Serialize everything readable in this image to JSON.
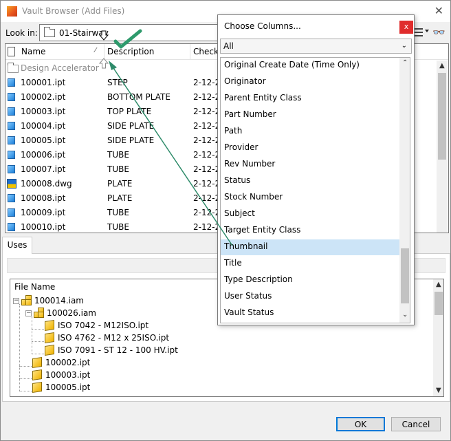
{
  "window": {
    "title": "Vault Browser (Add Files)",
    "close_glyph": "✕"
  },
  "lookin": {
    "label": "Look in:",
    "value": "01-Stairway"
  },
  "toolbar": {
    "view_icon": "details-view-icon",
    "find_icon": "binoculars-icon",
    "find_glyph": "👓"
  },
  "filelist": {
    "columns": [
      "Name",
      "Description",
      "Checke"
    ],
    "sort_glyph": "⁄",
    "group_label": "Design Accelerator",
    "rows": [
      {
        "name": "100001.ipt",
        "desc": "STEP",
        "date": "2-12-20",
        "type": "ipt"
      },
      {
        "name": "100002.ipt",
        "desc": "BOTTOM PLATE",
        "date": "2-12-20",
        "type": "ipt"
      },
      {
        "name": "100003.ipt",
        "desc": "TOP PLATE",
        "date": "2-12-20",
        "type": "ipt"
      },
      {
        "name": "100004.ipt",
        "desc": "SIDE PLATE",
        "date": "2-12-20",
        "type": "ipt"
      },
      {
        "name": "100005.ipt",
        "desc": "SIDE PLATE",
        "date": "2-12-20",
        "type": "ipt"
      },
      {
        "name": "100006.ipt",
        "desc": "TUBE",
        "date": "2-12-20",
        "type": "ipt"
      },
      {
        "name": "100007.ipt",
        "desc": "TUBE",
        "date": "2-12-20",
        "type": "ipt"
      },
      {
        "name": "100008.dwg",
        "desc": "PLATE",
        "date": "2-12-20",
        "type": "dwg"
      },
      {
        "name": "100008.ipt",
        "desc": "PLATE",
        "date": "2-12-20",
        "type": "ipt"
      },
      {
        "name": "100009.ipt",
        "desc": "TUBE",
        "date": "2-12-20",
        "type": "ipt"
      },
      {
        "name": "100010.ipt",
        "desc": "TUBE",
        "date": "2-12-20",
        "type": "ipt"
      }
    ]
  },
  "uses": {
    "tab_label": "Uses",
    "tree_header": "File Name",
    "nodes": [
      {
        "label": "100014.iam",
        "kind": "asm",
        "expand": "−"
      },
      {
        "label": "100026.iam",
        "kind": "asm",
        "expand": "−"
      },
      {
        "label": "ISO 7042 - M12ISO.ipt",
        "kind": "part"
      },
      {
        "label": "ISO 4762 - M12 x 25ISO.ipt",
        "kind": "part"
      },
      {
        "label": "ISO 7091 - ST 12 - 100 HV.ipt",
        "kind": "part"
      },
      {
        "label": "100002.ipt",
        "kind": "part"
      },
      {
        "label": "100003.ipt",
        "kind": "part"
      },
      {
        "label": "100005.ipt",
        "kind": "part"
      }
    ]
  },
  "buttons": {
    "ok": "OK",
    "cancel": "Cancel"
  },
  "choose_columns": {
    "title": "Choose Columns...",
    "close_glyph": "x",
    "filter_value": "All",
    "items": [
      "Original Create Date (Time Only)",
      "Originator",
      "Parent Entity Class",
      "Part Number",
      "Path",
      "Provider",
      "Rev Number",
      "Status",
      "Stock Number",
      "Subject",
      "Target Entity Class",
      "Thumbnail",
      "Title",
      "Type Description",
      "User Status",
      "Vault Status"
    ],
    "selected": "Thumbnail"
  },
  "colors": {
    "selection": "#cce4f7",
    "accent": "#0078d7",
    "close_red": "#e02c2c",
    "annotation": "#2e8b6a"
  }
}
